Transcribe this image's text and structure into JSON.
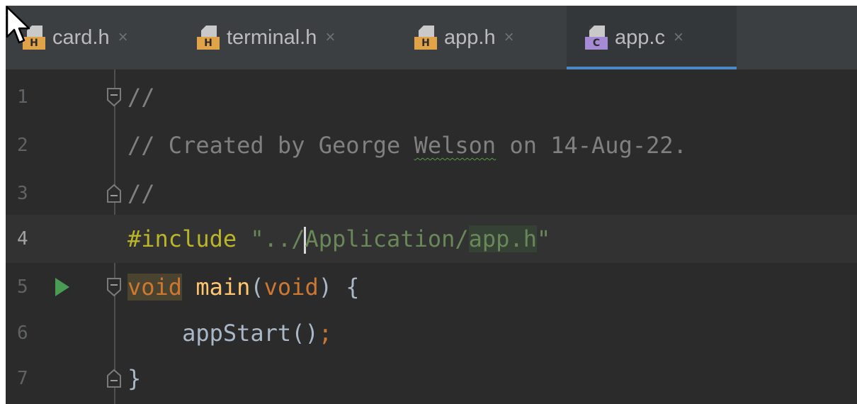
{
  "tabs": [
    {
      "name": "card.h",
      "type": "H",
      "active": false
    },
    {
      "name": "terminal.h",
      "type": "H",
      "active": false
    },
    {
      "name": "app.h",
      "type": "H",
      "active": false
    },
    {
      "name": "app.c",
      "type": "C",
      "active": true
    }
  ],
  "tab_close_glyph": "×",
  "editor": {
    "lines": [
      {
        "number": "1",
        "comment": "//"
      },
      {
        "number": "2",
        "comment_prefix": "// Created by George ",
        "comment_name": "Welson",
        "comment_suffix": " on 14-Aug-22."
      },
      {
        "number": "3",
        "comment": "//"
      },
      {
        "number": "4",
        "directive": "#include",
        "string_open": " \"../",
        "string_mid": "Application/",
        "string_file": "app.h",
        "string_close": "\""
      },
      {
        "number": "5",
        "kw_void": "void",
        "fn_name": " main",
        "paren_open": "(",
        "param": "void",
        "paren_close": ")",
        "brace": " {"
      },
      {
        "number": "6",
        "call": "    appStart()",
        "semi": ";"
      },
      {
        "number": "7",
        "brace_close": "}"
      }
    ],
    "current_line": "4",
    "run_gutter_line": "5"
  },
  "colors": {
    "background": "#2b2b2b",
    "tabbar": "#3c3f41",
    "active_tab_underline": "#4a88c7",
    "comment": "#808080",
    "keyword": "#cc7832",
    "preprocessor": "#bbb529",
    "string": "#6a8759",
    "function": "#ffc66d",
    "run_icon": "#499c54"
  },
  "icons": {
    "header_file": "h-file-icon",
    "c_file": "c-file-icon",
    "run": "run-triangle-icon",
    "fold": "fold-marker-icon",
    "cursor": "mouse-pointer-icon"
  }
}
